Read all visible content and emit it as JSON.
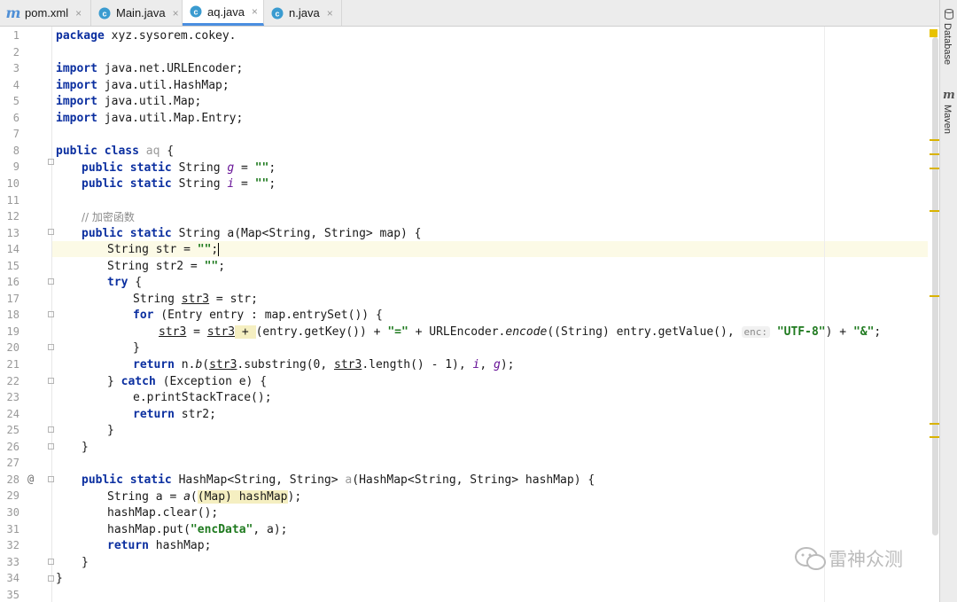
{
  "tabs": [
    {
      "label": "pom.xml",
      "icon": "maven-icon",
      "active": false
    },
    {
      "label": "Main.java",
      "icon": "java-class-icon",
      "active": false
    },
    {
      "label": "aq.java",
      "icon": "java-class-icon",
      "active": true
    },
    {
      "label": "n.java",
      "icon": "java-class-icon",
      "active": false
    }
  ],
  "close_glyph": "×",
  "sidebar": {
    "database": "Database",
    "maven": "Maven"
  },
  "watermark": "雷神众测",
  "line_numbers": [
    "1",
    "2",
    "3",
    "4",
    "5",
    "6",
    "7",
    "8",
    "9",
    "10",
    "11",
    "12",
    "13",
    "14",
    "15",
    "16",
    "17",
    "18",
    "19",
    "20",
    "21",
    "22",
    "23",
    "24",
    "25",
    "26",
    "27",
    "28",
    "29",
    "30",
    "31",
    "32",
    "33",
    "34",
    "35"
  ],
  "code": {
    "l1": {
      "kw": "package",
      "rest": " xyz.sysorem.cokey."
    },
    "l3": {
      "kw": "import",
      "rest": " java.net.URLEncoder;"
    },
    "l4": {
      "kw": "import",
      "rest": " java.util.HashMap;"
    },
    "l5": {
      "kw": "import",
      "rest": " java.util.Map;"
    },
    "l6": {
      "kw": "import",
      "rest": " java.util.Map.Entry;"
    },
    "l8": {
      "kw": "public class",
      "name": " aq",
      "rest": " {"
    },
    "l9": {
      "kw": "public static",
      "type": " String ",
      "field": "g",
      "eq": " = ",
      "str": "\"\"",
      "end": ";"
    },
    "l10": {
      "kw": "public static",
      "type": " String ",
      "field": "i",
      "eq": " = ",
      "str": "\"\"",
      "end": ";"
    },
    "l12": {
      "comment": "// 加密函数"
    },
    "l13": {
      "kw": "public static",
      "rest": " String a(Map<String, String> map) {"
    },
    "l14": {
      "pre": "String str = ",
      "str": "\"\"",
      "end": ";"
    },
    "l15": {
      "pre": "String str2 = ",
      "str": "\"\"",
      "end": ";"
    },
    "l16": {
      "kw": "try",
      "rest": " {"
    },
    "l17": {
      "pre": "String ",
      "var": "str3",
      "rest": " = str;"
    },
    "l18": {
      "kw": "for",
      "rest": " (Entry entry : map.entrySet()) {"
    },
    "l19": {
      "v1": "str3",
      "eq": " = ",
      "v2": "str3",
      "plus": " + ",
      "mid": "(entry.getKey()) + ",
      "s1": "\"=\"",
      "mid2": " + URLEncoder.",
      "m": "encode",
      "mid3": "((String) entry.getValue(), ",
      "hint": "enc:",
      "s2": "\"UTF-8\"",
      "mid4": ") + ",
      "s3": "\"&\"",
      "end": ";"
    },
    "l20": {
      "rest": "}"
    },
    "l21": {
      "kw": "return",
      "pre": " n.",
      "m": "b",
      "p1": "(",
      "v1": "str3",
      "p2": ".substring(0, ",
      "v2": "str3",
      "p3": ".length() - 1), ",
      "f1": "i",
      "p4": ", ",
      "f2": "g",
      "end": ");"
    },
    "l22": {
      "pre": "} ",
      "kw": "catch",
      "rest": " (Exception e) {"
    },
    "l23": {
      "rest": "e.printStackTrace();"
    },
    "l24": {
      "kw": "return",
      "rest": " str2;"
    },
    "l25": {
      "rest": "}"
    },
    "l26": {
      "rest": "}"
    },
    "l28": {
      "kw": "public static",
      "type": " HashMap<String, String> ",
      "name": "a",
      "rest": "(HashMap<String, String> hashMap) {"
    },
    "l29": {
      "pre": "String a = ",
      "m": "a",
      "paren": "(Map) hashMap",
      "open": "(",
      "end": ");"
    },
    "l30": {
      "rest": "hashMap.clear();"
    },
    "l31": {
      "pre": "hashMap.put(",
      "str": "\"encData\"",
      "end": ", a);"
    },
    "l32": {
      "kw": "return",
      "rest": " hashMap;"
    },
    "l33": {
      "rest": "}"
    },
    "l34": {
      "rest": "}"
    }
  },
  "gutter_marker": "@",
  "colors": {
    "keyword": "#0b2fa0",
    "string": "#1f7a1f",
    "field": "#650f95",
    "comment": "#8c8c8c",
    "tab_accent": "#4a8ee0",
    "warning_mark": "#d9b300"
  }
}
